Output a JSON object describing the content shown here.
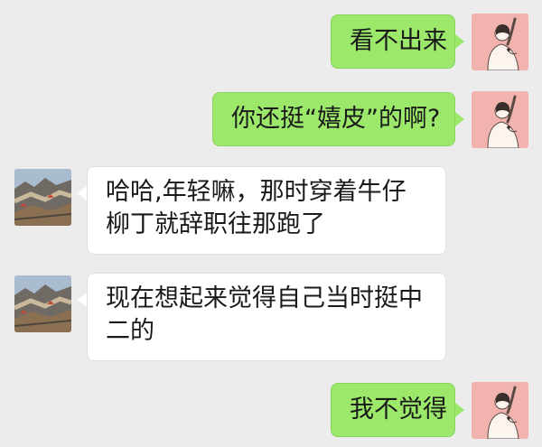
{
  "messages": [
    {
      "side": "out",
      "text": "看不出来"
    },
    {
      "side": "out",
      "text": "你还挺“嬉皮”的啊?"
    },
    {
      "side": "in",
      "text": "哈哈,年轻嘛，那时穿着牛仔柳丁就辞职往那跑了"
    },
    {
      "side": "in",
      "text": "现在想起来觉得自己当时挺中二的"
    },
    {
      "side": "out",
      "text": "我不觉得"
    }
  ],
  "colors": {
    "background": "#ececec",
    "outgoing_bubble": "#9be86a",
    "incoming_bubble": "#ffffff",
    "my_avatar_bg": "#f2b3ae"
  },
  "avatars": {
    "me": "woman-sketch-avatar",
    "other": "great-wall-photo-avatar"
  }
}
